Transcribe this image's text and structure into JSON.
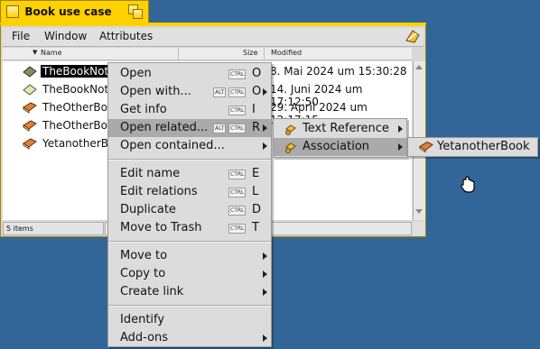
{
  "window": {
    "title": "Book use case",
    "accent_color": "#ffd100",
    "desktop_color": "#336698"
  },
  "menubar": {
    "items": [
      "File",
      "Window",
      "Attributes"
    ]
  },
  "columns": {
    "name": "Name",
    "size": "Size",
    "modified": "Modified"
  },
  "files": [
    {
      "name": "TheBookNote",
      "modified": "8. Mai 2024 um 15:30:28",
      "icon": "note-icon-olive",
      "selected": true
    },
    {
      "name": "TheBookNote",
      "modified": "14. Juni 2024 um 17:12:50",
      "icon": "note-icon-light",
      "selected": false
    },
    {
      "name": "TheOtherBoo",
      "modified": "29. April 2024 um 12:17:15",
      "icon": "book-icon",
      "selected": false
    },
    {
      "name": "TheOtherBoo",
      "modified": "",
      "icon": "book-icon",
      "selected": false
    },
    {
      "name": "YetanotherBo",
      "modified": "",
      "icon": "book-icon",
      "selected": false
    }
  ],
  "status": {
    "count": "5 items"
  },
  "context_menu": {
    "items": [
      {
        "label": "Open",
        "keys": [
          "CTRL"
        ],
        "letter": "O",
        "submenu": false
      },
      {
        "label": "Open with...",
        "keys": [
          "ALT",
          "CTRL"
        ],
        "letter": "O",
        "submenu": true
      },
      {
        "label": "Get info",
        "keys": [
          "CTRL"
        ],
        "letter": "I",
        "submenu": false
      },
      {
        "label": "Open related...",
        "keys": [
          "ALT",
          "CTRL"
        ],
        "letter": "R",
        "submenu": true,
        "highlighted": true
      },
      {
        "label": "Open contained...",
        "keys": [],
        "letter": "",
        "submenu": true
      },
      {
        "label": "Edit name",
        "keys": [
          "CTRL"
        ],
        "letter": "E",
        "submenu": false
      },
      {
        "label": "Edit relations",
        "keys": [
          "CTRL"
        ],
        "letter": "L",
        "submenu": false
      },
      {
        "label": "Duplicate",
        "keys": [
          "CTRL"
        ],
        "letter": "D",
        "submenu": false
      },
      {
        "label": "Move to Trash",
        "keys": [
          "CTRL"
        ],
        "letter": "T",
        "submenu": false
      },
      {
        "label": "Move to",
        "keys": [],
        "letter": "",
        "submenu": true
      },
      {
        "label": "Copy to",
        "keys": [],
        "letter": "",
        "submenu": true
      },
      {
        "label": "Create link",
        "keys": [],
        "letter": "",
        "submenu": true
      },
      {
        "label": "Identify",
        "keys": [],
        "letter": "",
        "submenu": false
      },
      {
        "label": "Add-ons",
        "keys": [],
        "letter": "",
        "submenu": true
      }
    ]
  },
  "related_menu": {
    "items": [
      {
        "label": "Text Reference",
        "icon": "relation-icon",
        "submenu": true
      },
      {
        "label": "Association",
        "icon": "relation-icon",
        "submenu": true,
        "highlighted": true
      }
    ]
  },
  "association_menu": {
    "items": [
      {
        "label": "YetanotherBook",
        "icon": "book-icon"
      }
    ]
  }
}
